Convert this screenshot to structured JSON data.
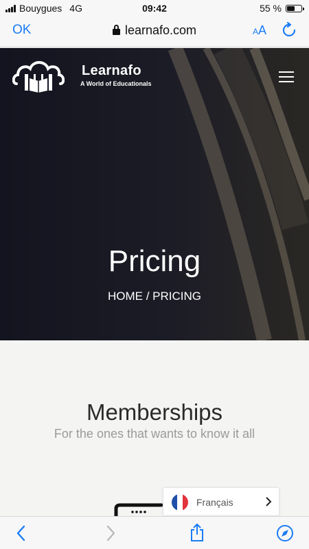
{
  "status_bar": {
    "carrier": "Bouygues",
    "network": "4G",
    "time": "09:42",
    "battery": "55 %",
    "battery_level": 0.55
  },
  "browser": {
    "done_label": "OK",
    "url": "learnafo.com",
    "text_size_label_small": "A",
    "text_size_label_large": "A",
    "accent_color": "#1a7cf5"
  },
  "site": {
    "brand_name": "Learnafo",
    "tagline": "A World of Educationals"
  },
  "hero": {
    "title": "Pricing",
    "breadcrumb": "HOME / PRICING"
  },
  "memberships": {
    "title": "Memberships",
    "subtitle": "For the ones that wants to know it all"
  },
  "language_picker": {
    "label": "Français",
    "flag_colors": [
      "#1f4fa8",
      "#ffffff",
      "#e1343c"
    ]
  },
  "toolbar": {
    "icons": [
      "back-icon",
      "forward-icon",
      "share-icon",
      "bookmarks-icon"
    ]
  }
}
